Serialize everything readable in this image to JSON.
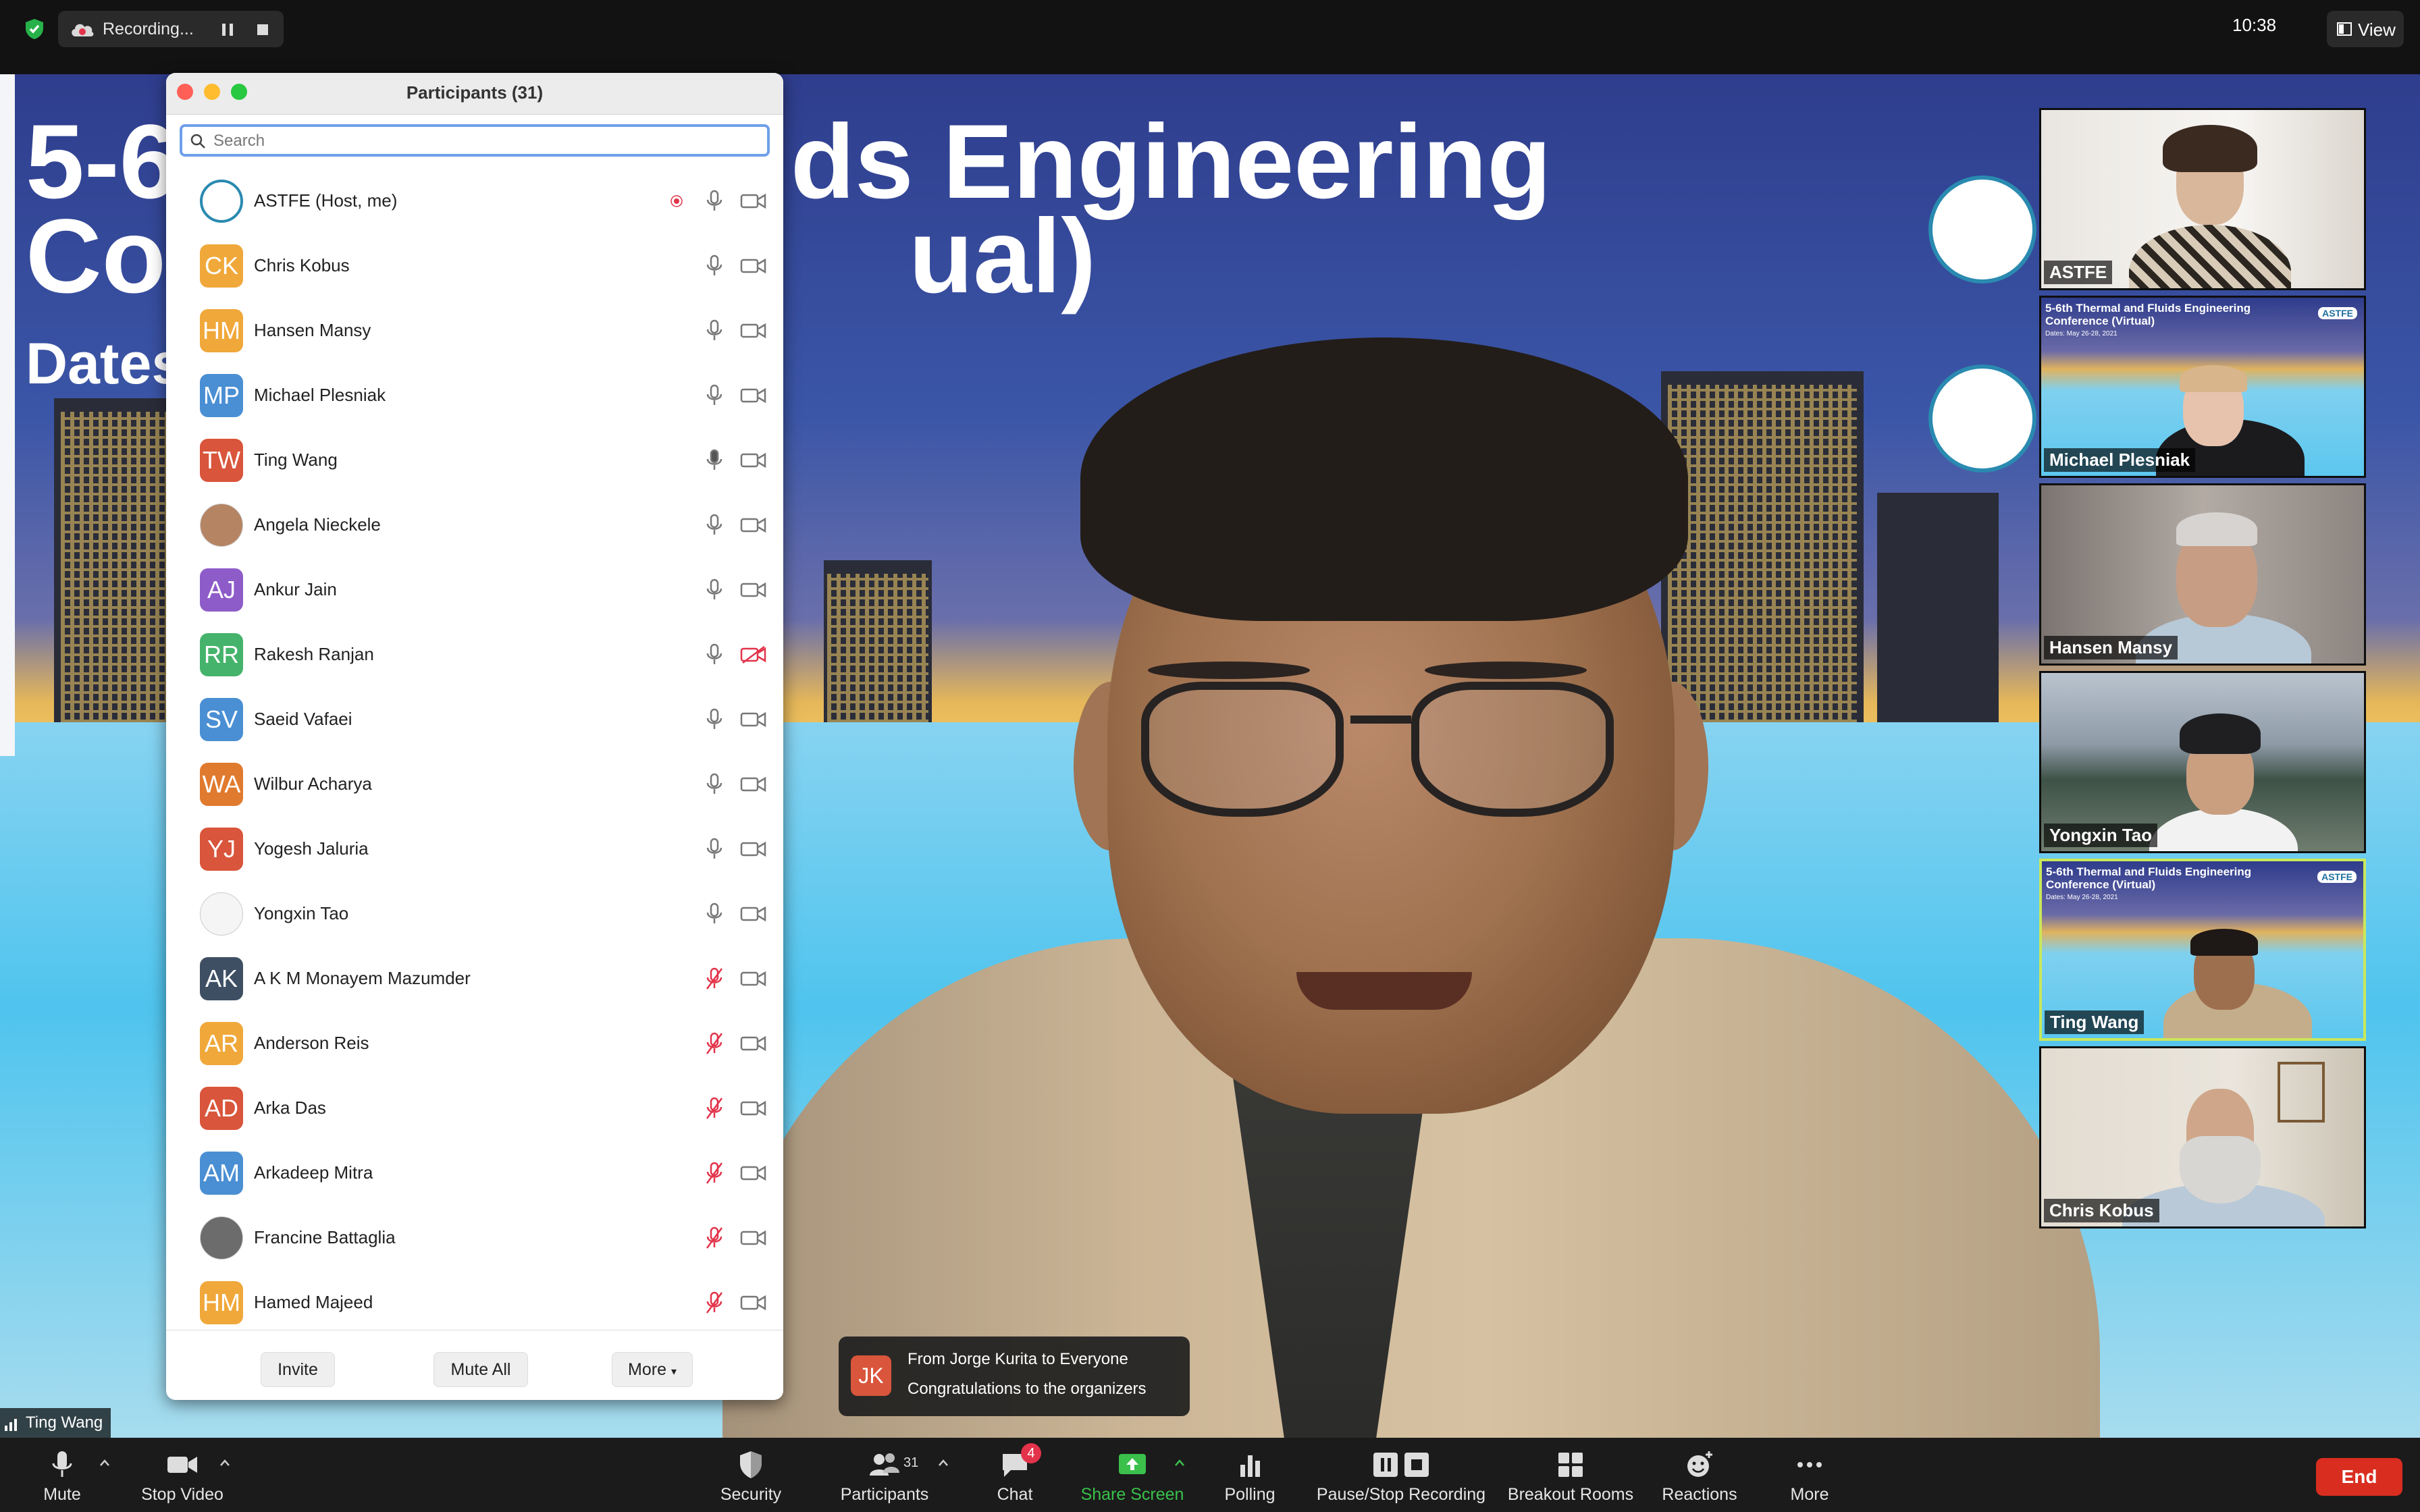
{
  "topbar": {
    "recording_label": "Recording...",
    "clock": "10:38",
    "view_label": "View"
  },
  "slide": {
    "title_line1": "5-6",
    "title_line1_right": "Fluids Engineering",
    "title_line2": "Co",
    "title_line2_right": "ual)",
    "dates_label": "Dates"
  },
  "participants": {
    "title": "Participants (31)",
    "search_placeholder": "Search",
    "list": [
      {
        "name": "ASTFE (Host, me)",
        "initials": "",
        "color": "#ffffff",
        "photo": "logo",
        "mic": "on",
        "cam": "on",
        "recording": true
      },
      {
        "name": "Chris Kobus",
        "initials": "CK",
        "color": "#f0a83a",
        "mic": "on",
        "cam": "on"
      },
      {
        "name": "Hansen Mansy",
        "initials": "HM",
        "color": "#f0a83a",
        "mic": "on",
        "cam": "on"
      },
      {
        "name": "Michael Plesniak",
        "initials": "MP",
        "color": "#4a8fd3",
        "mic": "on",
        "cam": "on"
      },
      {
        "name": "Ting Wang",
        "initials": "TW",
        "color": "#d9553b",
        "mic": "speaking",
        "cam": "on"
      },
      {
        "name": "Angela Nieckele",
        "initials": "",
        "color": "#b58463",
        "photo": "face",
        "mic": "on",
        "cam": "on"
      },
      {
        "name": "Ankur Jain",
        "initials": "AJ",
        "color": "#8e5cc9",
        "mic": "on",
        "cam": "on"
      },
      {
        "name": "Rakesh Ranjan",
        "initials": "RR",
        "color": "#45b36b",
        "mic": "on",
        "cam": "off"
      },
      {
        "name": "Saeid Vafaei",
        "initials": "SV",
        "color": "#4a8fd3",
        "mic": "on",
        "cam": "on"
      },
      {
        "name": "Wilbur Acharya",
        "initials": "WA",
        "color": "#e07a2e",
        "mic": "on",
        "cam": "on"
      },
      {
        "name": "Yogesh Jaluria",
        "initials": "YJ",
        "color": "#d9553b",
        "mic": "on",
        "cam": "on"
      },
      {
        "name": "Yongxin Tao",
        "initials": "",
        "color": "#ffffff",
        "photo": "slide",
        "mic": "on",
        "cam": "on"
      },
      {
        "name": "A K M Monayem Mazumder",
        "initials": "AK",
        "color": "#3e4f63",
        "mic": "muted",
        "cam": "on"
      },
      {
        "name": "Anderson Reis",
        "initials": "AR",
        "color": "#f0a83a",
        "mic": "muted",
        "cam": "on"
      },
      {
        "name": "Arka Das",
        "initials": "AD",
        "color": "#d9553b",
        "mic": "muted",
        "cam": "on"
      },
      {
        "name": "Arkadeep Mitra",
        "initials": "AM",
        "color": "#4a8fd3",
        "mic": "muted",
        "cam": "on"
      },
      {
        "name": "Francine Battaglia",
        "initials": "",
        "color": "#6c6c6c",
        "photo": "face2",
        "mic": "muted",
        "cam": "on"
      },
      {
        "name": "Hamed Majeed",
        "initials": "HM",
        "color": "#f0a83a",
        "mic": "muted",
        "cam": "on"
      }
    ],
    "buttons": {
      "invite": "Invite",
      "mute_all": "Mute All",
      "more": "More"
    }
  },
  "gallery": [
    {
      "label": "ASTFE",
      "type": "person-light"
    },
    {
      "label": "Michael Plesniak",
      "type": "slide"
    },
    {
      "label": "Hansen Mansy",
      "type": "person-grey"
    },
    {
      "label": "Yongxin Tao",
      "type": "mountain"
    },
    {
      "label": "Ting Wang",
      "type": "slide-active"
    },
    {
      "label": "Chris Kobus",
      "type": "person-beard"
    }
  ],
  "gallery_slide_text": {
    "title": "5-6th Thermal and Fluids Engineering Conference (Virtual)",
    "dates": "Dates: May 26-28, 2021",
    "badge": "ASTFE"
  },
  "chat_toast": {
    "initials": "JK",
    "from": "From Jorge Kurita to Everyone",
    "message": "Congratulations to the organizers"
  },
  "active_speaker": "Ting Wang",
  "toolbar": {
    "mute": "Mute",
    "stop_video": "Stop Video",
    "security": "Security",
    "participants": "Participants",
    "participants_count": "31",
    "chat": "Chat",
    "chat_badge": "4",
    "share_screen": "Share Screen",
    "polling": "Polling",
    "pause_stop_recording": "Pause/Stop Recording",
    "breakout_rooms": "Breakout Rooms",
    "reactions": "Reactions",
    "more": "More",
    "end": "End"
  },
  "colors": {
    "share_green": "#3ac04b",
    "end_red": "#d92d20",
    "search_focus": "#6f9fe9",
    "active_tile": "#c9e85a"
  }
}
